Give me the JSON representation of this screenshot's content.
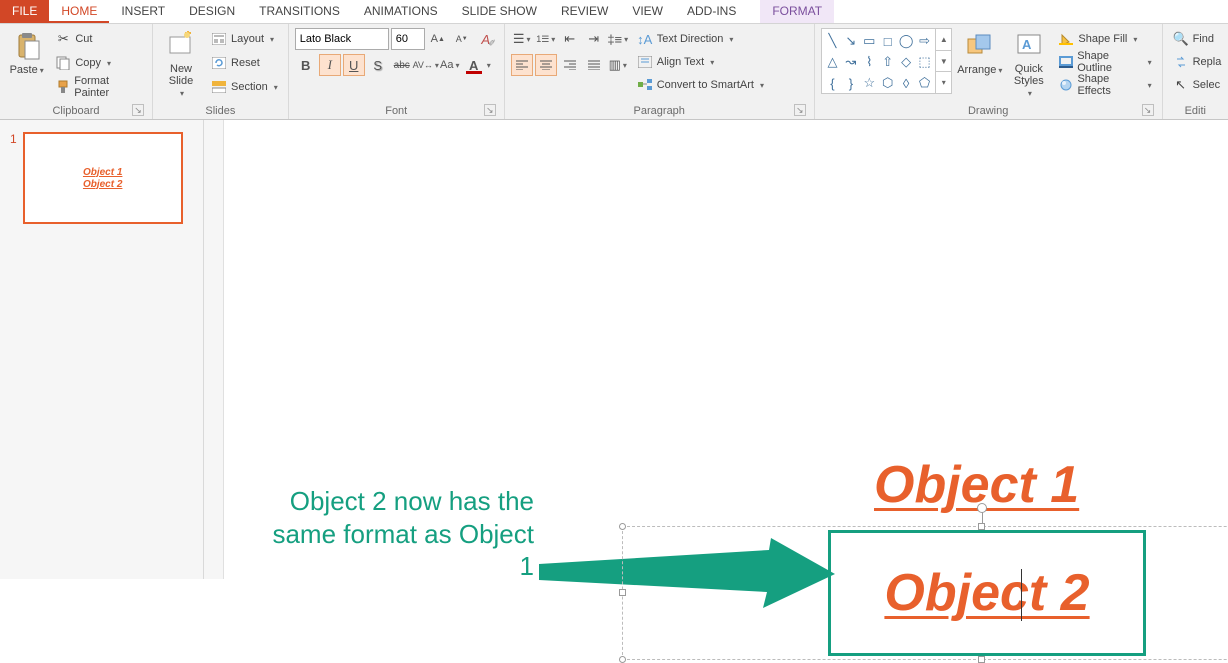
{
  "tabs": {
    "file": "FILE",
    "home": "HOME",
    "insert": "INSERT",
    "design": "DESIGN",
    "transitions": "TRANSITIONS",
    "animations": "ANIMATIONS",
    "slideshow": "SLIDE SHOW",
    "review": "REVIEW",
    "view": "VIEW",
    "addins": "ADD-INS",
    "format": "FORMAT"
  },
  "clipboard": {
    "paste": "Paste",
    "cut": "Cut",
    "copy": "Copy",
    "format_painter": "Format Painter",
    "group": "Clipboard"
  },
  "slides": {
    "new_slide": "New\nSlide",
    "layout": "Layout",
    "reset": "Reset",
    "section": "Section",
    "group": "Slides"
  },
  "font": {
    "name": "Lato Black",
    "size": "60",
    "bold": "B",
    "italic": "I",
    "underline": "U",
    "shadow": "S",
    "strike": "abc",
    "spacing": "AV",
    "case": "Aa",
    "group": "Font"
  },
  "paragraph": {
    "text_direction": "Text Direction",
    "align_text": "Align Text",
    "smartart": "Convert to SmartArt",
    "group": "Paragraph"
  },
  "drawing": {
    "arrange": "Arrange",
    "quick_styles": "Quick\nStyles",
    "shape_fill": "Shape Fill",
    "shape_outline": "Shape Outline",
    "shape_effects": "Shape Effects",
    "group": "Drawing"
  },
  "editing": {
    "find": "Find",
    "replace": "Repla",
    "select": "Selec",
    "group": "Editi"
  },
  "thumb": {
    "num": "1",
    "obj1": "Object 1",
    "obj2": "Object 2"
  },
  "slide": {
    "obj1": "Object 1",
    "obj2": "Object 2",
    "annotation": "Object 2 now has the same format as Object 1"
  }
}
